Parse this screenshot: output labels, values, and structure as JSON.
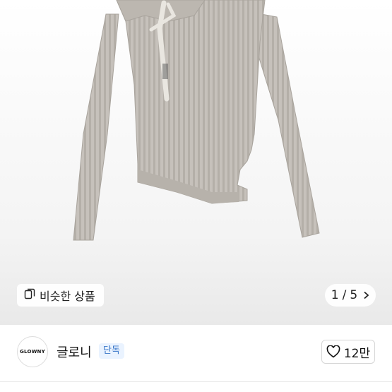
{
  "image": {
    "subject": "grey ribbed knit asymmetric long-sleeve top"
  },
  "similar": {
    "label": "비슷한 상품",
    "icon": "similar-items-icon"
  },
  "pager": {
    "current": "1",
    "separator": "/",
    "total": "5",
    "icon": "chevron-right-icon"
  },
  "seller": {
    "logo_text": "GLOWNY",
    "name": "글로니",
    "badge": "단독"
  },
  "like": {
    "count": "12만",
    "icon": "heart-outline-icon"
  },
  "colors": {
    "knit": "#c4bfb9",
    "badge_text": "#3b77c9",
    "badge_bg": "#eaf3ff"
  }
}
